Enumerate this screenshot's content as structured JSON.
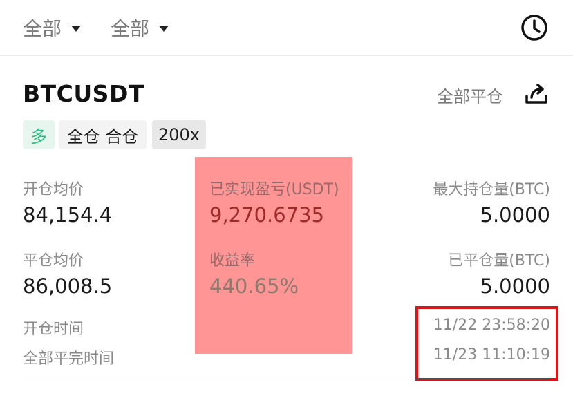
{
  "filters": {
    "filter_1_label": "全部",
    "filter_2_label": "全部",
    "history_icon": "clock-history-icon"
  },
  "position": {
    "symbol": "BTCUSDT",
    "close_all_label": "全部平仓",
    "share_icon": "share-icon",
    "tags": {
      "side": "多",
      "margin_mode": "全仓 合仓",
      "leverage": "200x"
    }
  },
  "stats": {
    "open_avg_label": "开仓均价",
    "open_avg_value": "84,154.4",
    "close_avg_label": "平仓均价",
    "close_avg_value": "86,008.5",
    "open_time_label": "开仓时间",
    "close_time_label": "全部平完时间",
    "realized_pnl_label": "已实现盈亏(USDT)",
    "realized_pnl_value": "9,270.6735",
    "yield_label": "收益率",
    "yield_value": "440.65%",
    "max_hold_label": "最大持仓量(BTC)",
    "max_hold_value": "5.0000",
    "closed_qty_label": "已平仓量(BTC)",
    "closed_qty_value": "5.0000",
    "open_time_value": "11/22 23:58:20",
    "close_time_value": "11/23 11:10:19"
  },
  "colors": {
    "long_green": "#2ebd85",
    "highlight_fill": "#ff9595",
    "annotation_red": "#e01414"
  }
}
